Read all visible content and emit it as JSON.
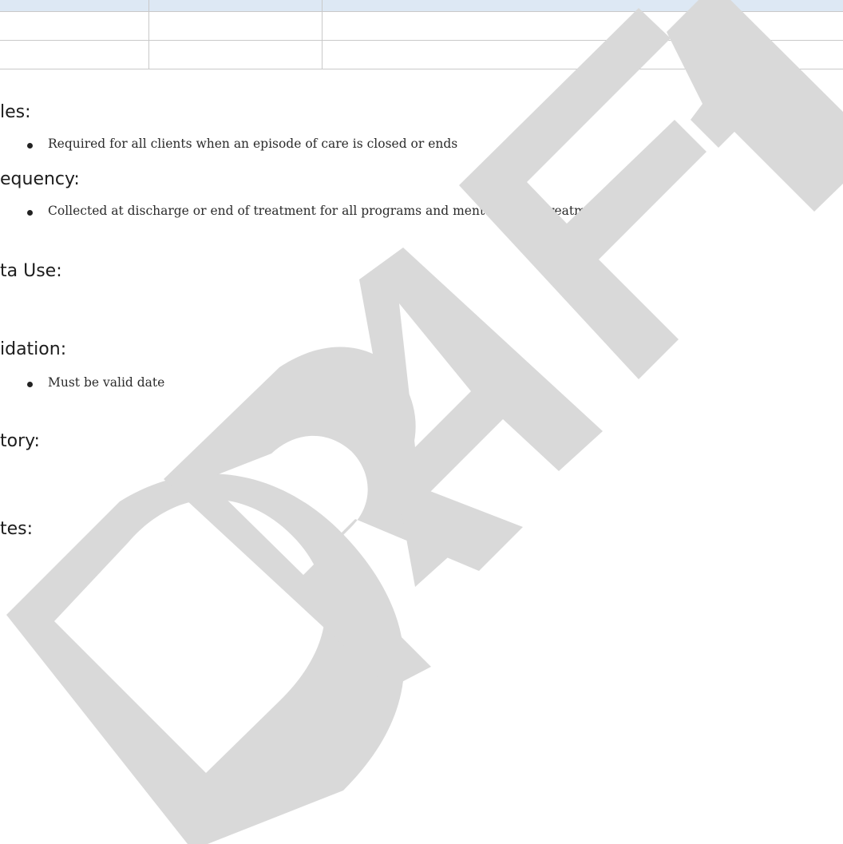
{
  "sections": [
    {
      "heading": "les:",
      "bullets": [
        "Required for all clients when an episode of care is closed or ends"
      ]
    },
    {
      "heading": "equency:",
      "bullets": [
        "Collected at discharge or end of treatment for all programs and mental health treatment"
      ]
    },
    {
      "heading": "ta Use:",
      "bullets": []
    },
    {
      "heading": "idation:",
      "bullets": [
        "Must be valid date"
      ]
    },
    {
      "heading": "tory:",
      "bullets": []
    },
    {
      "heading": "tes:",
      "bullets": []
    }
  ],
  "watermark": {
    "text": "DRAFT",
    "color": "#d9d9d9"
  },
  "colors": {
    "table_header": "#dde8f4",
    "table_border": "#c9c9c9"
  }
}
